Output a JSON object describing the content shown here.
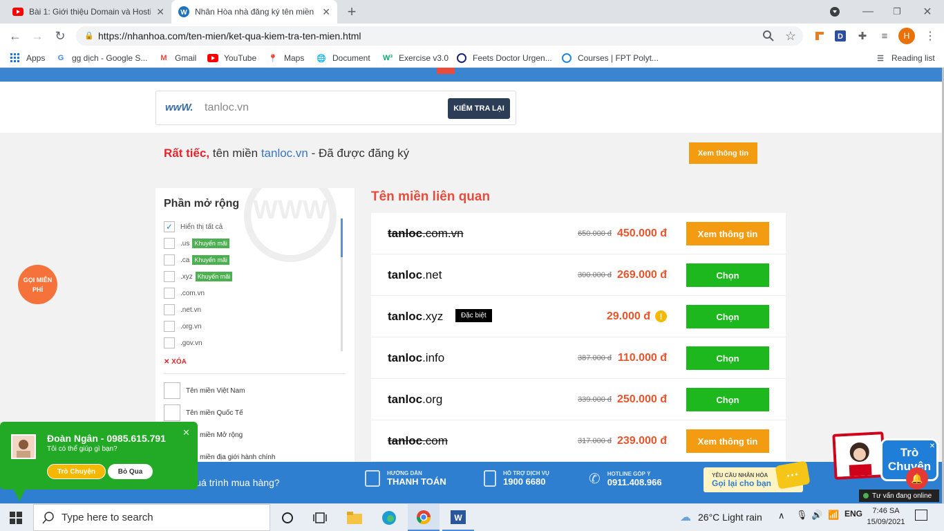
{
  "browser": {
    "tabs": [
      {
        "title": "Bài 1: Giới thiệu Domain và Hosti",
        "favicon": "youtube-icon",
        "active": false
      },
      {
        "title": "Nhân Hòa nhà đăng ký tên miền",
        "favicon": "wordpress-icon",
        "active": true
      }
    ],
    "new_tab": "+",
    "url": "https://nhanhoa.com/ten-mien/ket-qua-kiem-tra-ten-mien.html",
    "profile_initial": "H",
    "bookmarks": [
      {
        "label": "Apps",
        "icon": "apps-grid-icon"
      },
      {
        "label": "gg dịch - Google S...",
        "icon": "google-icon"
      },
      {
        "label": "Gmail",
        "icon": "gmail-icon"
      },
      {
        "label": "YouTube",
        "icon": "youtube-icon"
      },
      {
        "label": "Maps",
        "icon": "maps-pin-icon"
      },
      {
        "label": "Document",
        "icon": "globe-icon"
      },
      {
        "label": "Exercise v3.0",
        "icon": "w3-icon"
      },
      {
        "label": "Feets Doctor Urgen...",
        "icon": "feets-icon"
      },
      {
        "label": "Courses | FPT Polyt...",
        "icon": "fpt-ring-icon"
      }
    ],
    "reading_list": "Reading list"
  },
  "search": {
    "logo": "wwW.",
    "value": "tanloc.vn",
    "button": "KIỂM TRA LẠI"
  },
  "status": {
    "sorry": "Rất tiếc,",
    "prefix": "tên miền",
    "domain": "tanloc.vn",
    "suffix": "- Đã được đăng ký",
    "button": "Xem thông tin"
  },
  "call_bubble": {
    "line1": "GỌI MIỄN",
    "line2": "PHÍ"
  },
  "sidebar": {
    "title": "Phần mở rộng",
    "items": [
      {
        "label": "Hiển thị tất cả",
        "checked": true,
        "promo": ""
      },
      {
        "label": ".us",
        "checked": false,
        "promo": "Khuyến mãi"
      },
      {
        "label": ".ca",
        "checked": false,
        "promo": "Khuyến mãi"
      },
      {
        "label": ".xyz",
        "checked": false,
        "promo": "Khuyến mãi"
      },
      {
        "label": ".com.vn",
        "checked": false,
        "promo": ""
      },
      {
        "label": ".net.vn",
        "checked": false,
        "promo": ""
      },
      {
        "label": ".org.vn",
        "checked": false,
        "promo": ""
      },
      {
        "label": ".gov.vn",
        "checked": false,
        "promo": ""
      }
    ],
    "clear": "XÓA",
    "groups": [
      "Tên miền Việt Nam",
      "Tên miền Quốc Tế",
      "Tên miền Mở rộng",
      "Tên miền địa giới hành chính"
    ]
  },
  "results": {
    "title": "Tên miền liên quan",
    "rows": [
      {
        "name": "tanloc",
        "ext": ".com.vn",
        "old": "650.000 đ",
        "price": "450.000 đ",
        "action": "Xem thông tin",
        "taken": true,
        "badge": "",
        "warn": false
      },
      {
        "name": "tanloc",
        "ext": ".net",
        "old": "300.000 đ",
        "price": "269.000 đ",
        "action": "Chọn",
        "taken": false,
        "badge": "",
        "warn": false
      },
      {
        "name": "tanloc",
        "ext": ".xyz",
        "old": "",
        "price": "29.000 đ",
        "action": "Chọn",
        "taken": false,
        "badge": "Đặc biệt",
        "warn": true
      },
      {
        "name": "tanloc",
        "ext": ".info",
        "old": "387.000 đ",
        "price": "110.000 đ",
        "action": "Chọn",
        "taken": false,
        "badge": "",
        "warn": false
      },
      {
        "name": "tanloc",
        "ext": ".org",
        "old": "339.000 đ",
        "price": "250.000 đ",
        "action": "Chọn",
        "taken": false,
        "badge": "",
        "warn": false
      },
      {
        "name": "tanloc",
        "ext": ".com",
        "old": "317.000 đ",
        "price": "239.000 đ",
        "action": "Xem thông tin",
        "taken": true,
        "badge": "",
        "warn": false
      }
    ]
  },
  "bottom": {
    "process": "ng quá trình mua hàng?",
    "pay_label": "HƯỚNG DẪN",
    "pay_value": "THANH TOÁN",
    "support_label": "HỖ TRỢ DỊCH VỤ",
    "support_value": "1900 6680",
    "hotline_label": "HOTLINE GÓP Ý",
    "hotline_value": "0911.408.966",
    "callback_label": "YÊU CẦU NHÂN HÒA",
    "callback_value": "Gọi lại cho bạn"
  },
  "chat": {
    "name": "Đoàn Ngân - 0985.615.791",
    "message": "Tôi có thể giúp gì bạn?",
    "accept": "Trò Chuyện",
    "skip": "Bỏ Qua"
  },
  "widget": {
    "line1": "Trò",
    "line2": "Chuyện",
    "online": "Tư vấn đang online"
  },
  "taskbar": {
    "search": "Type here to search",
    "weather": "26°C  Light rain",
    "time": "7:46 SA",
    "date": "15/09/2021"
  }
}
